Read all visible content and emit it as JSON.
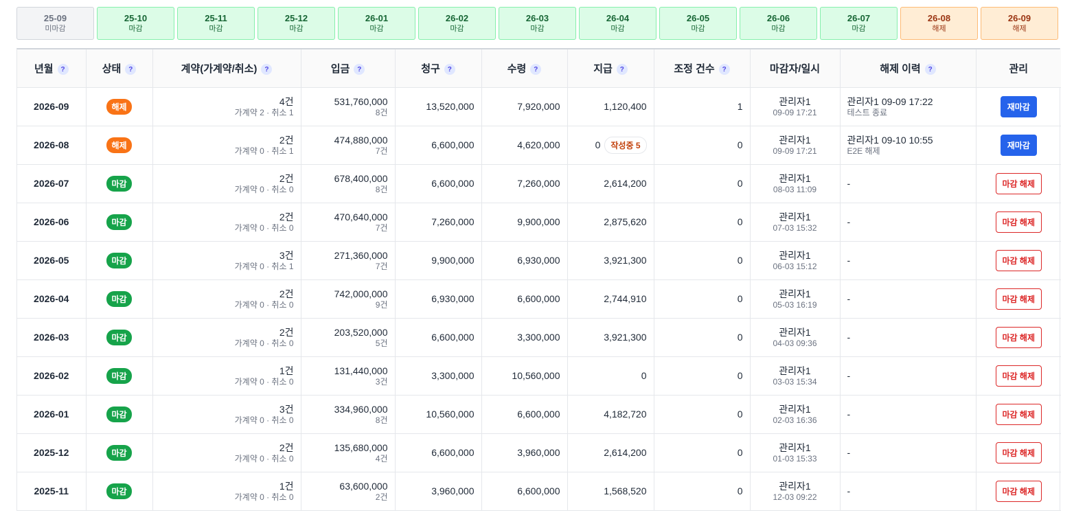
{
  "month_strip": [
    {
      "label": "25-09",
      "status": "미마감",
      "state": "open"
    },
    {
      "label": "25-10",
      "status": "마감",
      "state": "closed"
    },
    {
      "label": "25-11",
      "status": "마감",
      "state": "closed"
    },
    {
      "label": "25-12",
      "status": "마감",
      "state": "closed"
    },
    {
      "label": "26-01",
      "status": "마감",
      "state": "closed"
    },
    {
      "label": "26-02",
      "status": "마감",
      "state": "closed"
    },
    {
      "label": "26-03",
      "status": "마감",
      "state": "closed"
    },
    {
      "label": "26-04",
      "status": "마감",
      "state": "closed"
    },
    {
      "label": "26-05",
      "status": "마감",
      "state": "closed"
    },
    {
      "label": "26-06",
      "status": "마감",
      "state": "closed"
    },
    {
      "label": "26-07",
      "status": "마감",
      "state": "closed"
    },
    {
      "label": "26-08",
      "status": "해제",
      "state": "released"
    },
    {
      "label": "26-09",
      "status": "해제",
      "state": "released"
    }
  ],
  "table": {
    "headers": [
      {
        "key": "month",
        "label": "년월",
        "help": true
      },
      {
        "key": "status",
        "label": "상태",
        "help": true
      },
      {
        "key": "contracts",
        "label": "계약(가계약/취소)",
        "help": true
      },
      {
        "key": "deposit",
        "label": "입금",
        "help": true
      },
      {
        "key": "billing",
        "label": "청구",
        "help": true
      },
      {
        "key": "receipt",
        "label": "수령",
        "help": true
      },
      {
        "key": "payment",
        "label": "지급",
        "help": true
      },
      {
        "key": "adjust",
        "label": "조정 건수",
        "help": true
      },
      {
        "key": "closer",
        "label": "마감자/일시",
        "help": false
      },
      {
        "key": "release_history",
        "label": "해제 이력",
        "help": true
      },
      {
        "key": "manage",
        "label": "관리",
        "help": false
      }
    ],
    "help_glyph": "?",
    "rows": [
      {
        "month": "2026-09",
        "status": "해제",
        "state": "released",
        "contracts": "4건",
        "contracts_sub": "가계약 2 · 취소 1",
        "deposit": "531,760,000",
        "deposit_sub": "8건",
        "billing": "13,520,000",
        "receipt": "7,920,000",
        "payment": "1,120,400",
        "payment_badge": "",
        "adjust": "1",
        "closer": "관리자1",
        "closed_at": "09-09 17:21",
        "release": "관리자1 09-09 17:22",
        "release_sub": "테스트 종료",
        "action": "재마감"
      },
      {
        "month": "2026-08",
        "status": "해제",
        "state": "released",
        "contracts": "2건",
        "contracts_sub": "가계약 0 · 취소 1",
        "deposit": "474,880,000",
        "deposit_sub": "7건",
        "billing": "6,600,000",
        "receipt": "4,620,000",
        "payment": "0",
        "payment_badge": "작성중 5",
        "adjust": "0",
        "closer": "관리자1",
        "closed_at": "09-09 17:21",
        "release": "관리자1 09-10 10:55",
        "release_sub": "E2E 해제",
        "action": "재마감"
      },
      {
        "month": "2026-07",
        "status": "마감",
        "state": "closed",
        "contracts": "2건",
        "contracts_sub": "가계약 0 · 취소 0",
        "deposit": "678,400,000",
        "deposit_sub": "8건",
        "billing": "6,600,000",
        "receipt": "7,260,000",
        "payment": "2,614,200",
        "payment_badge": "",
        "adjust": "0",
        "closer": "관리자1",
        "closed_at": "08-03 11:09",
        "release": "-",
        "release_sub": "",
        "action": "마감 해제"
      },
      {
        "month": "2026-06",
        "status": "마감",
        "state": "closed",
        "contracts": "2건",
        "contracts_sub": "가계약 0 · 취소 0",
        "deposit": "470,640,000",
        "deposit_sub": "7건",
        "billing": "7,260,000",
        "receipt": "9,900,000",
        "payment": "2,875,620",
        "payment_badge": "",
        "adjust": "0",
        "closer": "관리자1",
        "closed_at": "07-03 15:32",
        "release": "-",
        "release_sub": "",
        "action": "마감 해제"
      },
      {
        "month": "2026-05",
        "status": "마감",
        "state": "closed",
        "contracts": "3건",
        "contracts_sub": "가계약 0 · 취소 1",
        "deposit": "271,360,000",
        "deposit_sub": "7건",
        "billing": "9,900,000",
        "receipt": "6,930,000",
        "payment": "3,921,300",
        "payment_badge": "",
        "adjust": "0",
        "closer": "관리자1",
        "closed_at": "06-03 15:12",
        "release": "-",
        "release_sub": "",
        "action": "마감 해제"
      },
      {
        "month": "2026-04",
        "status": "마감",
        "state": "closed",
        "contracts": "2건",
        "contracts_sub": "가계약 0 · 취소 0",
        "deposit": "742,000,000",
        "deposit_sub": "9건",
        "billing": "6,930,000",
        "receipt": "6,600,000",
        "payment": "2,744,910",
        "payment_badge": "",
        "adjust": "0",
        "closer": "관리자1",
        "closed_at": "05-03 16:19",
        "release": "-",
        "release_sub": "",
        "action": "마감 해제"
      },
      {
        "month": "2026-03",
        "status": "마감",
        "state": "closed",
        "contracts": "2건",
        "contracts_sub": "가계약 0 · 취소 0",
        "deposit": "203,520,000",
        "deposit_sub": "5건",
        "billing": "6,600,000",
        "receipt": "3,300,000",
        "payment": "3,921,300",
        "payment_badge": "",
        "adjust": "0",
        "closer": "관리자1",
        "closed_at": "04-03 09:36",
        "release": "-",
        "release_sub": "",
        "action": "마감 해제"
      },
      {
        "month": "2026-02",
        "status": "마감",
        "state": "closed",
        "contracts": "1건",
        "contracts_sub": "가계약 0 · 취소 0",
        "deposit": "131,440,000",
        "deposit_sub": "3건",
        "billing": "3,300,000",
        "receipt": "10,560,000",
        "payment": "0",
        "payment_badge": "",
        "adjust": "0",
        "closer": "관리자1",
        "closed_at": "03-03 15:34",
        "release": "-",
        "release_sub": "",
        "action": "마감 해제"
      },
      {
        "month": "2026-01",
        "status": "마감",
        "state": "closed",
        "contracts": "3건",
        "contracts_sub": "가계약 0 · 취소 0",
        "deposit": "334,960,000",
        "deposit_sub": "8건",
        "billing": "10,560,000",
        "receipt": "6,600,000",
        "payment": "4,182,720",
        "payment_badge": "",
        "adjust": "0",
        "closer": "관리자1",
        "closed_at": "02-03 16:36",
        "release": "-",
        "release_sub": "",
        "action": "마감 해제"
      },
      {
        "month": "2025-12",
        "status": "마감",
        "state": "closed",
        "contracts": "2건",
        "contracts_sub": "가계약 0 · 취소 0",
        "deposit": "135,680,000",
        "deposit_sub": "4건",
        "billing": "6,600,000",
        "receipt": "3,960,000",
        "payment": "2,614,200",
        "payment_badge": "",
        "adjust": "0",
        "closer": "관리자1",
        "closed_at": "01-03 15:33",
        "release": "-",
        "release_sub": "",
        "action": "마감 해제"
      },
      {
        "month": "2025-11",
        "status": "마감",
        "state": "closed",
        "contracts": "1건",
        "contracts_sub": "가계약 0 · 취소 0",
        "deposit": "63,600,000",
        "deposit_sub": "2건",
        "billing": "3,960,000",
        "receipt": "6,600,000",
        "payment": "1,568,520",
        "payment_badge": "",
        "adjust": "0",
        "closer": "관리자1",
        "closed_at": "12-03 09:22",
        "release": "-",
        "release_sub": "",
        "action": "마감 해제"
      }
    ]
  },
  "colors": {
    "chip_open": "#f3f4f6",
    "chip_closed": "#dcfce7",
    "chip_released": "#ffedd5",
    "badge_released": "#f97316",
    "badge_closed": "#16a34a",
    "button_reclose": "#2563eb",
    "button_release": "#dc2626"
  }
}
